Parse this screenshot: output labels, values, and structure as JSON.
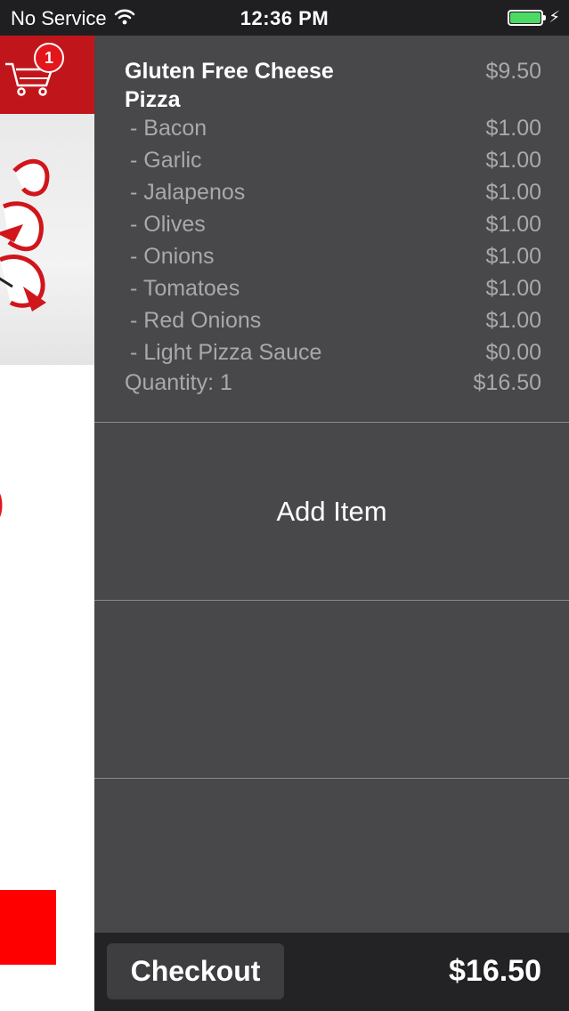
{
  "status_bar": {
    "carrier": "No Service",
    "time": "12:36 PM",
    "battery_level": 1.0,
    "battery_color": "#4cd964"
  },
  "background_app": {
    "cart_badge_count": "1",
    "brand_color": "#c0161b"
  },
  "cart": {
    "item": {
      "name": "Gluten Free Cheese Pizza",
      "price": "$9.50",
      "options": [
        {
          "label": " - Bacon",
          "price": "$1.00"
        },
        {
          "label": " - Garlic",
          "price": "$1.00"
        },
        {
          "label": " - Jalapenos",
          "price": "$1.00"
        },
        {
          "label": " - Olives",
          "price": "$1.00"
        },
        {
          "label": " - Onions",
          "price": "$1.00"
        },
        {
          "label": " - Tomatoes",
          "price": "$1.00"
        },
        {
          "label": " - Red Onions",
          "price": "$1.00"
        },
        {
          "label": " - Light Pizza Sauce",
          "price": "$0.00"
        }
      ],
      "quantity_label": "Quantity: 1",
      "line_total": "$16.50"
    },
    "add_item_label": "Add Item",
    "checkout_label": "Checkout",
    "total": "$16.50"
  }
}
